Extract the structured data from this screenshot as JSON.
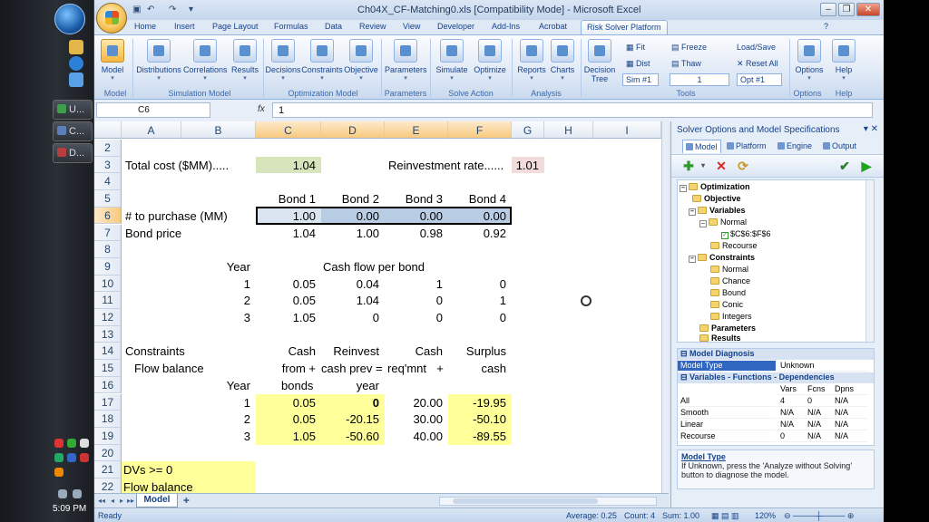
{
  "window": {
    "title": "Ch04X_CF-Matching0.xls  [Compatibility Mode] - Microsoft Excel",
    "controls": {
      "minimize": "–",
      "restore": "❐",
      "close": "✕"
    }
  },
  "taskbar": {
    "items": [
      {
        "label": "U..."
      },
      {
        "label": "C..."
      },
      {
        "label": "D..."
      }
    ],
    "time": "5:09 PM"
  },
  "ribbon": {
    "tabs": [
      "Home",
      "Insert",
      "Page Layout",
      "Formulas",
      "Data",
      "Review",
      "View",
      "Developer",
      "Add-Ins",
      "Acrobat",
      "Risk Solver Platform"
    ],
    "active_tab": "Risk Solver Platform",
    "buttons": {
      "model": "Model",
      "distributions": "Distributions",
      "correlations": "Correlations",
      "results": "Results",
      "decisions": "Decisions",
      "constraints": "Constraints",
      "objective": "Objective",
      "parameters": "Parameters",
      "simulate": "Simulate",
      "optimize": "Optimize",
      "reports": "Reports",
      "charts": "Charts",
      "decision_tree": "Decision Tree",
      "options": "Options",
      "help": "Help"
    },
    "small": {
      "fit": "Fit",
      "dist": "Dist",
      "freeze": "Freeze",
      "thaw": "Thaw",
      "load_save": "Load/Save",
      "reset_all": "Reset All",
      "sim_combo": "Sim #1",
      "num_combo": "1",
      "opt_combo": "Opt #1"
    },
    "groups": {
      "model": "Model",
      "simulation": "Simulation Model",
      "optimization": "Optimization Model",
      "parameters": "Parameters",
      "solve": "Solve Action",
      "analysis": "Analysis",
      "tools": "Tools",
      "options": "Options",
      "help": "Help"
    }
  },
  "formula_bar": {
    "cell_ref": "C6",
    "fx": "fx",
    "value": "1"
  },
  "sheet": {
    "columns": [
      "A",
      "B",
      "C",
      "D",
      "E",
      "F",
      "G",
      "H",
      "I"
    ],
    "rows": [
      "2",
      "3",
      "4",
      "5",
      "6",
      "7",
      "8",
      "9",
      "10",
      "11",
      "12",
      "13",
      "14",
      "15",
      "16",
      "17",
      "18",
      "19",
      "20",
      "21",
      "22"
    ],
    "cells": {
      "a3": "Total cost ($MM).....",
      "c3": "1.04",
      "e3": "Reinvestment rate......",
      "g3": "1.01",
      "c5": "Bond 1",
      "d5": "Bond 2",
      "e5": "Bond 3",
      "f5": "Bond 4",
      "a6": "# to purchase (MM)",
      "c6": "1.00",
      "d6": "0.00",
      "e6": "0.00",
      "f6": "0.00",
      "a7": "Bond price",
      "c7": "1.04",
      "d7": "1.00",
      "e7": "0.98",
      "f7": "0.92",
      "b9": "Year",
      "d9": "Cash flow per bond",
      "b10": "1",
      "c10": "0.05",
      "d10": "0.04",
      "e10": "1",
      "f10": "0",
      "b11": "2",
      "c11": "0.05",
      "d11": "1.04",
      "e11": "0",
      "f11": "1",
      "b12": "3",
      "c12": "1.05",
      "d12": "0",
      "e12": "0",
      "f12": "0",
      "a14": "Constraints",
      "c14": "Cash",
      "d14": "Reinvest",
      "e14": "Cash",
      "f14": "Surplus",
      "a15": "Flow balance",
      "c15": "from +",
      "d15": "cash prev =",
      "e15": "req'mnt",
      "e15b": "+",
      "f15": "cash",
      "b16": "Year",
      "c16": "bonds",
      "d16": "year",
      "b17": "1",
      "c17": "0.05",
      "d17": "0",
      "e17": "20.00",
      "f17": "-19.95",
      "b18": "2",
      "c18": "0.05",
      "d18": "-20.15",
      "e18": "30.00",
      "f18": "-50.10",
      "b19": "3",
      "c19": "1.05",
      "d19": "-50.60",
      "e19": "40.00",
      "f19": "-89.55",
      "a21": "DVs >= 0",
      "a22": "Flow balance"
    },
    "sheet_tab": "Model"
  },
  "status": {
    "ready": "Ready",
    "average": "Average: 0.25",
    "count": "Count: 4",
    "sum": "Sum: 1.00",
    "zoom": "120%"
  },
  "pane": {
    "title": "Solver Options and Model Specifications",
    "tabs": [
      "Model",
      "Platform",
      "Engine",
      "Output"
    ],
    "tree": {
      "optimization": "Optimization",
      "objective": "Objective",
      "variables": "Variables",
      "normal": "Normal",
      "var_range": "$C$6:$F$6",
      "recourse": "Recourse",
      "constraints": "Constraints",
      "c_normal": "Normal",
      "chance": "Chance",
      "bound": "Bound",
      "conic": "Conic",
      "integers": "Integers",
      "parameters": "Parameters",
      "results": "Results"
    },
    "props": {
      "diag_head": "Model Diagnosis",
      "model_type_key": "Model Type",
      "model_type_val": "Unknown",
      "vfd_head": "Variables - Functions - Dependencies",
      "cols": [
        "Vars",
        "Fcns",
        "Dpns"
      ],
      "rows": [
        {
          "name": "All",
          "vals": [
            "4",
            "0",
            "N/A"
          ]
        },
        {
          "name": "Smooth",
          "vals": [
            "N/A",
            "N/A",
            "N/A"
          ]
        },
        {
          "name": "Linear",
          "vals": [
            "N/A",
            "N/A",
            "N/A"
          ]
        },
        {
          "name": "Recourse",
          "vals": [
            "0",
            "N/A",
            "N/A"
          ]
        }
      ]
    },
    "desc": {
      "title": "Model Type",
      "text": "If Unknown, press the 'Analyze without Solving' button to diagnose the model."
    }
  }
}
